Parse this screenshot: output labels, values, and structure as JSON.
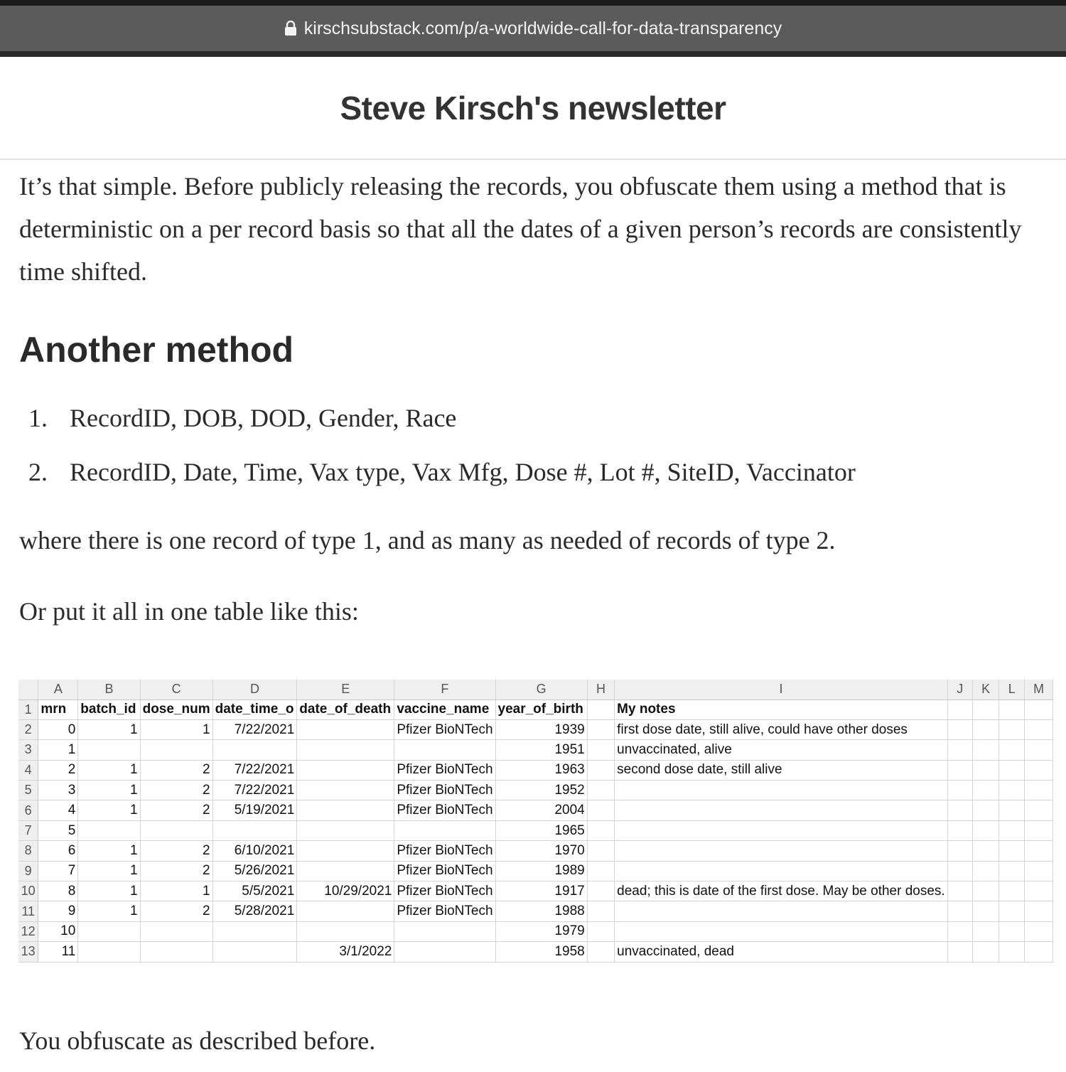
{
  "browser": {
    "url": "kirschsubstack.com/p/a-worldwide-call-for-data-transparency"
  },
  "publication": {
    "title": "Steve Kirsch's newsletter"
  },
  "article": {
    "para1": "It’s that simple. Before publicly releasing the records, you obfuscate them using a method that is deterministic on a per record basis so that all the dates of a given person’s records are consistently time shifted.",
    "heading": "Another method",
    "list": [
      {
        "num": "1.",
        "text": "RecordID, DOB, DOD, Gender, Race"
      },
      {
        "num": "2.",
        "text": "RecordID, Date, Time, Vax type, Vax Mfg, Dose #, Lot #, SiteID, Vaccinator"
      }
    ],
    "para2": "where there is one record of type 1, and as many as needed of records of type 2.",
    "para3": "Or put it all in one table like this:",
    "para4": "You obfuscate as described before."
  },
  "spreadsheet": {
    "column_letters": [
      "A",
      "B",
      "C",
      "D",
      "E",
      "F",
      "G",
      "H",
      "I",
      "J",
      "K",
      "L",
      "M"
    ],
    "row_numbers": [
      "1",
      "2",
      "3",
      "4",
      "5",
      "6",
      "7",
      "8",
      "9",
      "10",
      "11",
      "12",
      "13"
    ],
    "header": [
      "mrn",
      "batch_id",
      "dose_num",
      "date_time_o",
      "date_of_death",
      "vaccine_name",
      "year_of_birth",
      "",
      "My notes",
      "",
      "",
      "",
      ""
    ],
    "rows": [
      [
        "0",
        "1",
        "1",
        "7/22/2021",
        "",
        "Pfizer BioNTech",
        "1939",
        "",
        "first dose date, still alive, could have other doses",
        "",
        "",
        "",
        ""
      ],
      [
        "1",
        "",
        "",
        "",
        "",
        "",
        "1951",
        "",
        "unvaccinated, alive",
        "",
        "",
        "",
        ""
      ],
      [
        "2",
        "1",
        "2",
        "7/22/2021",
        "",
        "Pfizer BioNTech",
        "1963",
        "",
        "second dose date, still alive",
        "",
        "",
        "",
        ""
      ],
      [
        "3",
        "1",
        "2",
        "7/22/2021",
        "",
        "Pfizer BioNTech",
        "1952",
        "",
        "",
        "",
        "",
        "",
        ""
      ],
      [
        "4",
        "1",
        "2",
        "5/19/2021",
        "",
        "Pfizer BioNTech",
        "2004",
        "",
        "",
        "",
        "",
        "",
        ""
      ],
      [
        "5",
        "",
        "",
        "",
        "",
        "",
        "1965",
        "",
        "",
        "",
        "",
        "",
        ""
      ],
      [
        "6",
        "1",
        "2",
        "6/10/2021",
        "",
        "Pfizer BioNTech",
        "1970",
        "",
        "",
        "",
        "",
        "",
        ""
      ],
      [
        "7",
        "1",
        "2",
        "5/26/2021",
        "",
        "Pfizer BioNTech",
        "1989",
        "",
        "",
        "",
        "",
        "",
        ""
      ],
      [
        "8",
        "1",
        "1",
        "5/5/2021",
        "10/29/2021",
        "Pfizer BioNTech",
        "1917",
        "",
        "dead; this is date of the first dose. May be other doses.",
        "",
        "",
        "",
        ""
      ],
      [
        "9",
        "1",
        "2",
        "5/28/2021",
        "",
        "Pfizer BioNTech",
        "1988",
        "",
        "",
        "",
        "",
        "",
        ""
      ],
      [
        "10",
        "",
        "",
        "",
        "",
        "",
        "1979",
        "",
        "",
        "",
        "",
        "",
        ""
      ],
      [
        "11",
        "",
        "",
        "",
        "3/1/2022",
        "",
        "1958",
        "",
        "unvaccinated, dead",
        "",
        "",
        "",
        ""
      ]
    ]
  }
}
